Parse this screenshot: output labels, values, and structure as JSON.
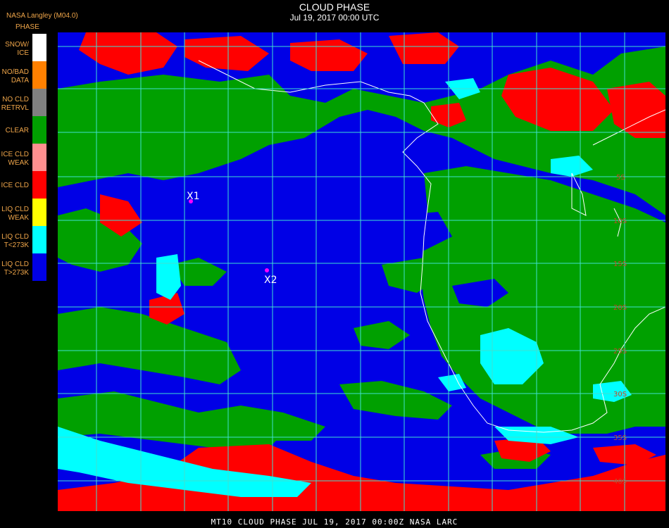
{
  "header": {
    "org": "NASA Langley (M04.0)",
    "legend_title": "PHASE",
    "title": "CLOUD PHASE",
    "subtitle": "Jul 19, 2017 00:00 UTC"
  },
  "legend": [
    {
      "label": "SNOW/\nICE",
      "color": "#ffffff"
    },
    {
      "label": "NO/BAD\nDATA",
      "color": "#ff8000"
    },
    {
      "label": "NO CLD\nRETRVL",
      "color": "#808080"
    },
    {
      "label": "CLEAR",
      "color": "#00a000"
    },
    {
      "label": "ICE CLD\nWEAK",
      "color": "#ff9090"
    },
    {
      "label": "ICE CLD",
      "color": "#ff0000"
    },
    {
      "label": "LIQ CLD\nWEAK",
      "color": "#ffff00"
    },
    {
      "label": "LIQ CLD\nT<273K",
      "color": "#00ffff"
    },
    {
      "label": "LIQ CLD\nT>273K",
      "color": "#0000e6"
    }
  ],
  "markers": [
    {
      "label": "X1",
      "color": "#ff00ff"
    },
    {
      "label": "X2",
      "color": "#ff00ff"
    }
  ],
  "lat_labels": [
    "5S",
    "10S",
    "15S",
    "20S",
    "25S",
    "30S",
    "35S",
    "40S"
  ],
  "colors": {
    "grid": "#40e0d0",
    "coast": "#ffffff",
    "liquid_warm": "#0000e6",
    "liquid_cold": "#00ffff",
    "clear": "#00a000",
    "ice": "#ff0000"
  },
  "footer": "MT10  CLOUD PHASE   JUL 19, 2017 00:00Z   NASA LARC"
}
